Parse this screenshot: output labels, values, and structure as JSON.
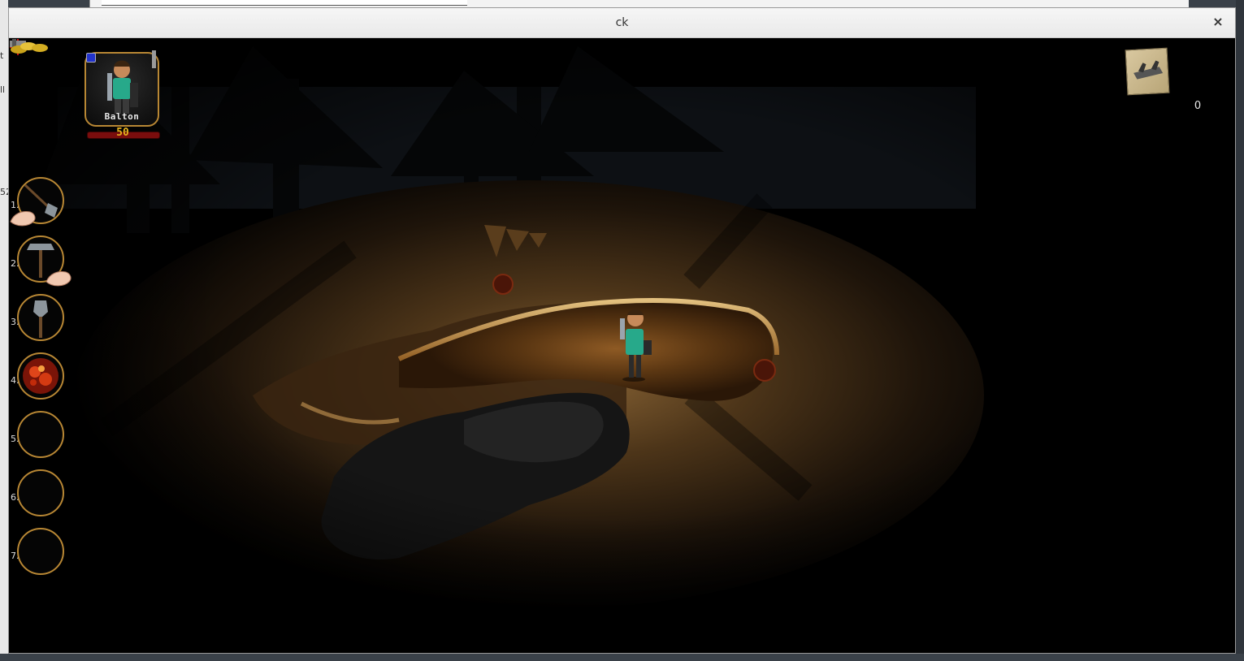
{
  "window": {
    "title": "ck",
    "close_glyph": "×"
  },
  "background_fragments": [
    "t",
    "ll",
    "52",
    "1.",
    "2.",
    "3.",
    "4."
  ],
  "hud": {
    "character": {
      "name": "Balton",
      "health": "50",
      "health_fraction": 1.0
    },
    "inventory": {
      "slots": [
        {
          "number": "1.",
          "item": "pickaxe-and-shovel"
        },
        {
          "number": "2.",
          "item": "hammer"
        },
        {
          "number": "3.",
          "item": "shovel"
        },
        {
          "number": "4.",
          "item": "lava-rock"
        },
        {
          "number": "5.",
          "item": ""
        },
        {
          "number": "6.",
          "item": ""
        },
        {
          "number": "7.",
          "item": ""
        }
      ]
    },
    "map": {
      "icon": "treasure-map-icon"
    },
    "gold": {
      "count": "0",
      "icon": "gold-coins-icon"
    }
  },
  "colors": {
    "slot_border": "#b88734",
    "health_bar": "#7a0d0d",
    "health_text": "#e6b21e",
    "crosshair": "#d01010",
    "character_shirt": "#27a98a"
  }
}
